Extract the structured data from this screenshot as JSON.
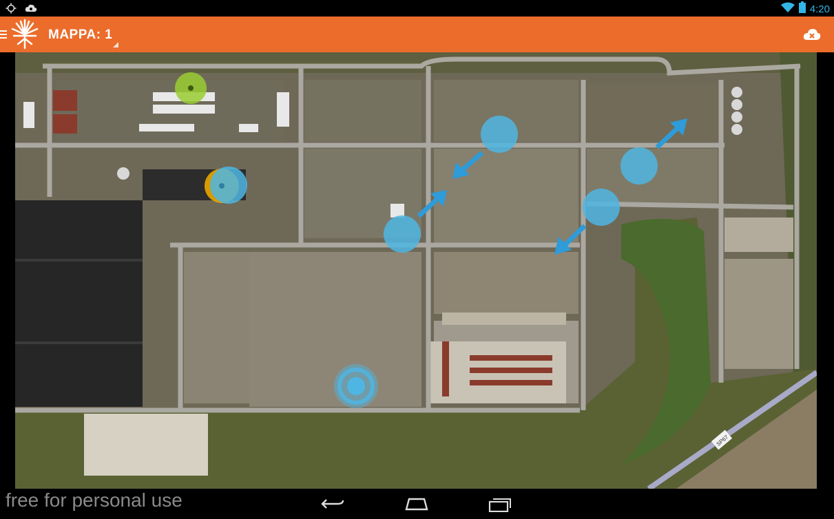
{
  "status_bar": {
    "time": "4:20",
    "icons": [
      "location-icon",
      "cloud-notification-icon",
      "wifi-icon",
      "battery-icon"
    ]
  },
  "action_bar": {
    "title": "MAPPA: 1",
    "background_color": "#ec6c2b",
    "icons": [
      "drawer-menu-icon",
      "tree-logo-icon",
      "cloud-sync-icon"
    ]
  },
  "map": {
    "type": "satellite",
    "markers": [
      {
        "name": "green-marker",
        "color": "#9acd32"
      },
      {
        "name": "blue-marker-with-yellow",
        "color": "#4fb6e3"
      },
      {
        "name": "blue-marker",
        "color": "#4fb6e3"
      },
      {
        "name": "blue-marker",
        "color": "#4fb6e3"
      },
      {
        "name": "blue-marker",
        "color": "#4fb6e3"
      },
      {
        "name": "blue-marker",
        "color": "#4fb6e3"
      },
      {
        "name": "current-location-marker",
        "color": "#4fb6e3"
      }
    ],
    "arrows": 4,
    "road_sign": "SP67"
  },
  "watermark": "free for personal use",
  "nav_bar": {
    "icons": [
      "back-icon",
      "home-icon",
      "recent-apps-icon"
    ]
  }
}
